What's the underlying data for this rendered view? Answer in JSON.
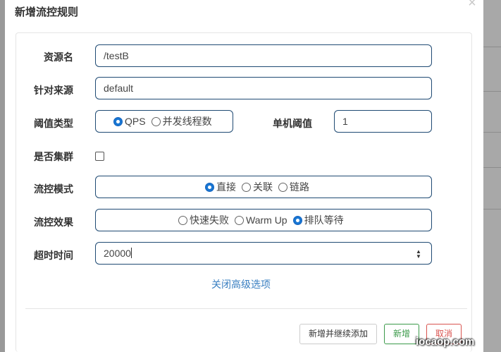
{
  "dialog": {
    "title": "新增流控规则",
    "close_glyph": "×"
  },
  "form": {
    "resource": {
      "label": "资源名",
      "value": "/testB"
    },
    "origin": {
      "label": "针对来源",
      "value": "default"
    },
    "threshold_type": {
      "label": "阈值类型",
      "options": [
        "QPS",
        "并发线程数"
      ],
      "selected": "QPS"
    },
    "single_threshold": {
      "label": "单机阈值",
      "value": "1"
    },
    "cluster": {
      "label": "是否集群",
      "checked": false
    },
    "mode": {
      "label": "流控模式",
      "options": [
        "直接",
        "关联",
        "链路"
      ],
      "selected": "直接"
    },
    "effect": {
      "label": "流控效果",
      "options": [
        "快速失败",
        "Warm Up",
        "排队等待"
      ],
      "selected": "排队等待"
    },
    "timeout": {
      "label": "超时时间",
      "value": "20000"
    },
    "advanced_toggle": "关闭高级选项"
  },
  "footer": {
    "add_continue": "新增并继续添加",
    "add": "新增",
    "cancel": "取消"
  },
  "watermark": "iocaop.com",
  "colors": {
    "input_border": "#1f4a73",
    "radio_on": "#1976d2",
    "link": "#3a7fc1",
    "success": "#3b9a4a",
    "danger": "#d9534f"
  }
}
